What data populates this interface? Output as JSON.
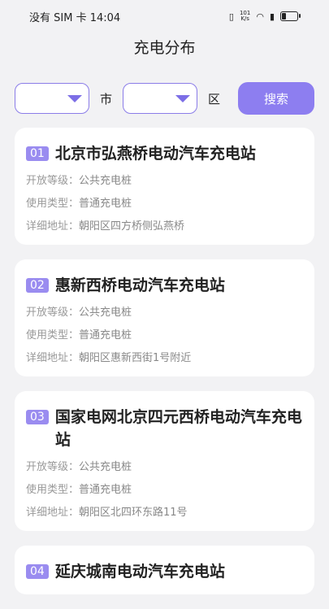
{
  "status_bar": {
    "carrier_time": "没有 SIM 卡 14:04",
    "net_speed_top": "101",
    "net_speed_bottom": "K/s"
  },
  "page_title": "充电分布",
  "filter": {
    "city_value": "",
    "city_unit": "市",
    "district_value": "",
    "district_unit": "区",
    "search_label": "搜索"
  },
  "labels": {
    "open_level": "开放等级：",
    "use_type": "使用类型：",
    "address": "详细地址："
  },
  "stations": [
    {
      "num": "01",
      "name": "北京市弘燕桥电动汽车充电站",
      "open_level": "公共充电桩",
      "use_type": "普通充电桩",
      "address": "朝阳区四方桥侧弘燕桥"
    },
    {
      "num": "02",
      "name": "惠新西桥电动汽车充电站",
      "open_level": "公共充电桩",
      "use_type": "普通充电桩",
      "address": "朝阳区惠新西街1号附近"
    },
    {
      "num": "03",
      "name": "国家电网北京四元西桥电动汽车充电站",
      "open_level": "公共充电桩",
      "use_type": "普通充电桩",
      "address": "朝阳区北四环东路11号"
    },
    {
      "num": "04",
      "name": "延庆城南电动汽车充电站"
    }
  ],
  "colors": {
    "accent": "#8d7ef0",
    "badge": "#9a8cf0"
  }
}
